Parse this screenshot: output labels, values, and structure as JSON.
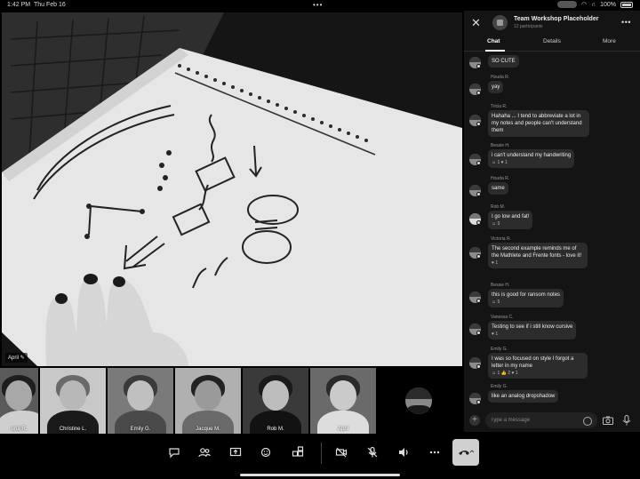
{
  "status_bar": {
    "time": "1:42 PM",
    "date": "Thu Feb 16",
    "battery": "100%"
  },
  "main_video": {
    "presenter": "April"
  },
  "participants": [
    {
      "name": "Gloria R.",
      "label": "oria R."
    },
    {
      "name": "Christine L.",
      "label": "Christine L."
    },
    {
      "name": "Emily G.",
      "label": "Emily G."
    },
    {
      "name": "Jacque M.",
      "label": "Jacque M."
    },
    {
      "name": "Rob M.",
      "label": "Rob M."
    },
    {
      "name": "April",
      "label": "April"
    }
  ],
  "panel": {
    "title": "Team Workshop Placeholder",
    "subtitle": "12 participants",
    "tabs": [
      "Chat",
      "Details",
      "More"
    ]
  },
  "messages": [
    {
      "sender": "",
      "text": "SO CUTE",
      "reaction": ""
    },
    {
      "sender": "Houda R.",
      "text": "yay",
      "reaction": ""
    },
    {
      "sender": "Tricia R.",
      "text": "Hahaha ... I tend to abbreviate a lot in my notes and people can't understand them",
      "reaction": ""
    },
    {
      "sender": "Bessie H.",
      "text": "i can't understand my handwriting",
      "reaction": "☺ 1  ♥ 1"
    },
    {
      "sender": "Houda R.",
      "text": "same",
      "reaction": ""
    },
    {
      "sender": "Rob M.",
      "text": "I go low and fat!",
      "reaction": "☺ 3"
    },
    {
      "sender": "Victoria R.",
      "text": "The second example reminds me of the Mathlete and Frente fonts - love it!",
      "reaction": "♥ 1"
    },
    {
      "sender": "Bessie H.",
      "text": "this is good for ransom notes",
      "reaction": "☺ 5"
    },
    {
      "sender": "Vanessa C.",
      "text": "Testing to see if i still know cursive",
      "reaction": "♥ 1"
    },
    {
      "sender": "Emily G.",
      "text": "I was so focused on style I forgot a letter in my name",
      "reaction": "☺ 1  👍 2  ♥ 1"
    },
    {
      "sender": "Emily G.",
      "text": "like an analog dropshadow",
      "reaction": ""
    }
  ],
  "compose": {
    "placeholder": "Type a message"
  },
  "icons": {
    "toolbar": [
      "chat-icon",
      "people-icon",
      "share-screen-icon",
      "reactions-icon",
      "apps-icon",
      "video-off-icon",
      "mic-off-icon",
      "speaker-icon",
      "more-icon",
      "hang-up-icon"
    ]
  }
}
